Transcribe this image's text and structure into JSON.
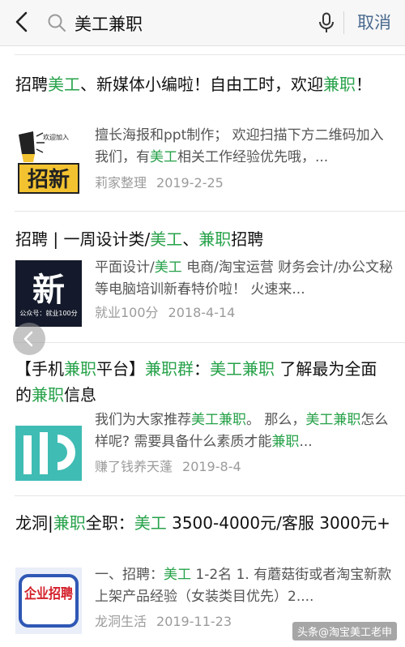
{
  "search": {
    "query": "美工兼职",
    "cancel_label": "取消"
  },
  "results": [
    {
      "title": [
        {
          "t": "招聘"
        },
        {
          "t": "美工",
          "h": true
        },
        {
          "t": "、新媒体小编啦！自由工时，欢迎"
        },
        {
          "t": "兼职",
          "h": true
        },
        {
          "t": "！"
        }
      ],
      "thumb": {
        "top_text": "欢迎加入",
        "main_text": "招新"
      },
      "snippet": [
        {
          "t": "擅长海报和ppt制作； 欢迎扫描下方二维码加入我们，有"
        },
        {
          "t": "美工",
          "h": true
        },
        {
          "t": "相关工作经验优先哦，..."
        }
      ],
      "source": "莉家整理",
      "date": "2019-2-25"
    },
    {
      "title": [
        {
          "t": "招聘 | 一周设计类/"
        },
        {
          "t": "美工",
          "h": true
        },
        {
          "t": "、"
        },
        {
          "t": "兼职",
          "h": true
        },
        {
          "t": "招聘"
        }
      ],
      "thumb": {
        "main_text": "新",
        "caption": "公众号：就业100分"
      },
      "snippet": [
        {
          "t": "平面设计/"
        },
        {
          "t": "美工",
          "h": true
        },
        {
          "t": " 电商/淘宝运营 财务会计/办公文秘等电脑培训新春特价啦！ 火速来..."
        }
      ],
      "source": "就业100分",
      "date": "2018-4-14"
    },
    {
      "title": [
        {
          "t": "【手机"
        },
        {
          "t": "兼职",
          "h": true
        },
        {
          "t": "平台】"
        },
        {
          "t": "兼职群",
          "h": true
        },
        {
          "t": "："
        },
        {
          "t": "美工兼职",
          "h": true
        },
        {
          "t": " 了解最为全面的"
        },
        {
          "t": "兼职",
          "h": true
        },
        {
          "t": "信息"
        }
      ],
      "thumb": {},
      "snippet": [
        {
          "t": "我们为大家推荐"
        },
        {
          "t": "美工兼职",
          "h": true
        },
        {
          "t": "。 那么，"
        },
        {
          "t": "美工兼职",
          "h": true
        },
        {
          "t": "怎么样呢? 需要具备什么素质才能"
        },
        {
          "t": "兼职",
          "h": true
        },
        {
          "t": "..."
        }
      ],
      "source": "赚了钱养天蓬",
      "date": "2019-8-4"
    },
    {
      "title": [
        {
          "t": "龙洞|"
        },
        {
          "t": "兼职",
          "h": true
        },
        {
          "t": "全职："
        },
        {
          "t": "美工",
          "h": true
        },
        {
          "t": " 3500-4000元/客服 3000元+"
        }
      ],
      "thumb": {
        "main_text": "企业招聘"
      },
      "snippet": [
        {
          "t": "一、招聘："
        },
        {
          "t": "美工",
          "h": true
        },
        {
          "t": " 1-2名 1. 有蘑菇街或者淘宝新款上架产品经验（女装类目优先）2...."
        }
      ],
      "source": "龙洞生活",
      "date": "2019-11-23"
    }
  ],
  "watermark": "头条@淘宝美工老申",
  "colors": {
    "highlight": "#27a24a",
    "cancel": "#4a6a8f",
    "meta": "#9b9b9b"
  }
}
